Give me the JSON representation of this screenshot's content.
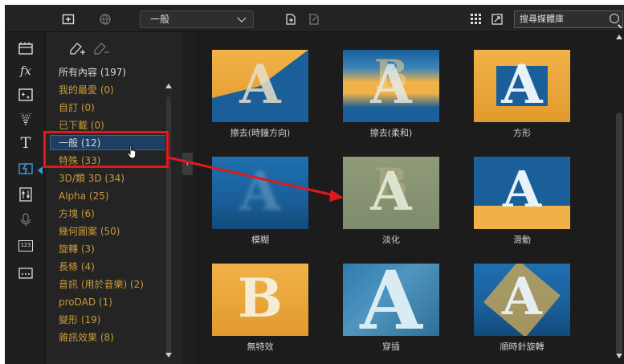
{
  "toolbar": {
    "select_value": "一般",
    "search_placeholder": "搜尋媒體庫",
    "icons": [
      "import-media-icon",
      "globe-icon",
      "add-to-library-icon",
      "export-icon",
      "grid-view-icon",
      "expand-icon",
      "search-icon"
    ]
  },
  "rail": {
    "icons": [
      "media-room-icon",
      "fx-icon",
      "pip-objects-icon",
      "particle-icon",
      "title-icon",
      "transition-icon",
      "audio-mixing-icon",
      "voice-over-icon",
      "chapter-icon",
      "subtitle-icon"
    ],
    "labels": {
      "fx": "fx",
      "title": "T",
      "chapter": "123"
    }
  },
  "panel": {
    "categories": [
      {
        "label": "所有內容 (197)",
        "color": "white"
      },
      {
        "label": "我的最愛 (0)",
        "color": "gold"
      },
      {
        "label": "自訂 (0)",
        "color": "gold"
      },
      {
        "label": "已下載 (0)",
        "color": "gold"
      },
      {
        "label": "一般 (12)",
        "color": "white",
        "selected": true
      },
      {
        "label": "特殊 (33)",
        "color": "gold"
      },
      {
        "label": "3D/類 3D (34)",
        "color": "gold"
      },
      {
        "label": "Alpha (25)",
        "color": "gold"
      },
      {
        "label": "方塊 (6)",
        "color": "gold"
      },
      {
        "label": "幾何圖案 (50)",
        "color": "gold"
      },
      {
        "label": "旋轉 (3)",
        "color": "gold"
      },
      {
        "label": "長條 (4)",
        "color": "gold"
      },
      {
        "label": "音訊 (用於音樂) (2)",
        "color": "gold"
      },
      {
        "label": "proDAD (1)",
        "color": "gold"
      },
      {
        "label": "變形 (19)",
        "color": "gold"
      },
      {
        "label": "雜訊效果 (8)",
        "color": "gold"
      }
    ]
  },
  "grid": {
    "tiles": [
      {
        "caption": "擦去(時鐘方向)",
        "letter": "A"
      },
      {
        "caption": "擦去(柔和)",
        "letter": "A"
      },
      {
        "caption": "方形",
        "letter": "A"
      },
      {
        "caption": "模糊",
        "letter": "A"
      },
      {
        "caption": "淡化",
        "letter": "A"
      },
      {
        "caption": "滑動",
        "letter": "A"
      },
      {
        "caption": "無特效",
        "letter": "B"
      },
      {
        "caption": "穿插",
        "letter": "A"
      },
      {
        "caption": "順時針旋轉",
        "letter": "A"
      }
    ],
    "letter_b": "B"
  },
  "colors": {
    "accent": "#3a9ae0",
    "category_gold": "#c99a3a",
    "annotation_red": "#e0191b"
  }
}
